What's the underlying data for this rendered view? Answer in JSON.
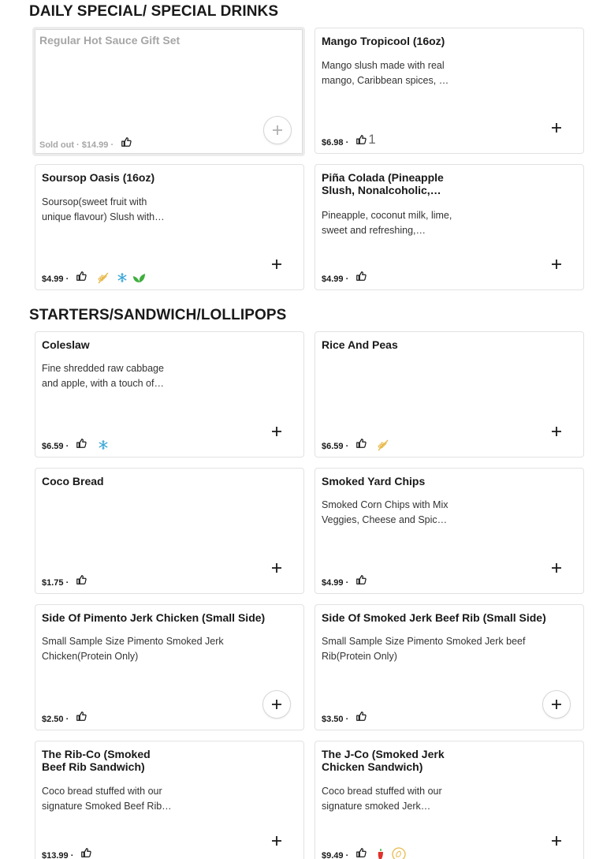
{
  "sections": [
    {
      "title": "DAILY SPECIAL/ SPECIAL DRINKS"
    },
    {
      "title": "STARTERS/SANDWICH/LOLLIPOPS"
    }
  ],
  "items": [
    {
      "title": "Regular Hot Sauce Gift Set",
      "desc": "",
      "price": "Sold out · $14.99 ·",
      "likes": ""
    },
    {
      "title": "Mango Tropicool (16oz)",
      "desc": "Mango slush made with real mango, Caribbean spices, …",
      "price": "$6.98 ·",
      "likes": "1"
    },
    {
      "title": "Soursop Oasis (16oz)",
      "desc": "Soursop(sweet fruit with unique flavour) Slush with…",
      "price": "$4.99 ·",
      "likes": ""
    },
    {
      "title": "Piña Colada (Pineapple Slush, Nonalcoholic,…",
      "desc": "Pineapple, coconut milk, lime, sweet and refreshing,…",
      "price": "$4.99 ·",
      "likes": ""
    },
    {
      "title": "Coleslaw",
      "desc": "Fine shredded raw cabbage and apple, with a touch of…",
      "price": "$6.59 ·",
      "likes": ""
    },
    {
      "title": "Rice And Peas",
      "desc": "",
      "price": "$6.59 ·",
      "likes": ""
    },
    {
      "title": "Coco Bread",
      "desc": "",
      "price": "$1.75 ·",
      "likes": ""
    },
    {
      "title": "Smoked Yard Chips",
      "desc": "Smoked Corn Chips with Mix Veggies, Cheese and Spic…",
      "price": "$4.99 ·",
      "likes": ""
    },
    {
      "title": "Side Of Pimento Jerk Chicken (Small Side)",
      "desc": "Small Sample Size Pimento Smoked Jerk Chicken(Protein Only)",
      "price": "$2.50 ·",
      "likes": ""
    },
    {
      "title": "Side Of Smoked Jerk Beef Rib (Small Side)",
      "desc": "Small Sample Size Pimento Smoked Jerk beef Rib(Protein Only)",
      "price": "$3.50 ·",
      "likes": ""
    },
    {
      "title": "The Rib-Co (Smoked Beef Rib Sandwich)",
      "desc": "Coco bread stuffed with our signature Smoked Beef Rib…",
      "price": "$13.99 ·",
      "likes": ""
    },
    {
      "title": "The J-Co (Smoked Jerk Chicken Sandwich)",
      "desc": "Coco bread stuffed with our signature smoked Jerk…",
      "price": "$9.49 ·",
      "likes": ""
    }
  ],
  "icons": {
    "thumb": "thumbs-up-icon",
    "gluten_free": "wheat-icon",
    "dairy_free": "snowflake-icon",
    "vegan": "leaf-icon",
    "spicy": "chili-icon",
    "nut": "nut-icon",
    "add": "plus-icon"
  },
  "colors": {
    "gluten_free": "#e8b94a",
    "dairy_free": "#3aa6d8",
    "vegan": "#3fae3f",
    "spicy": "#e0322b",
    "text": "#191919",
    "muted": "#a6a6a6"
  }
}
